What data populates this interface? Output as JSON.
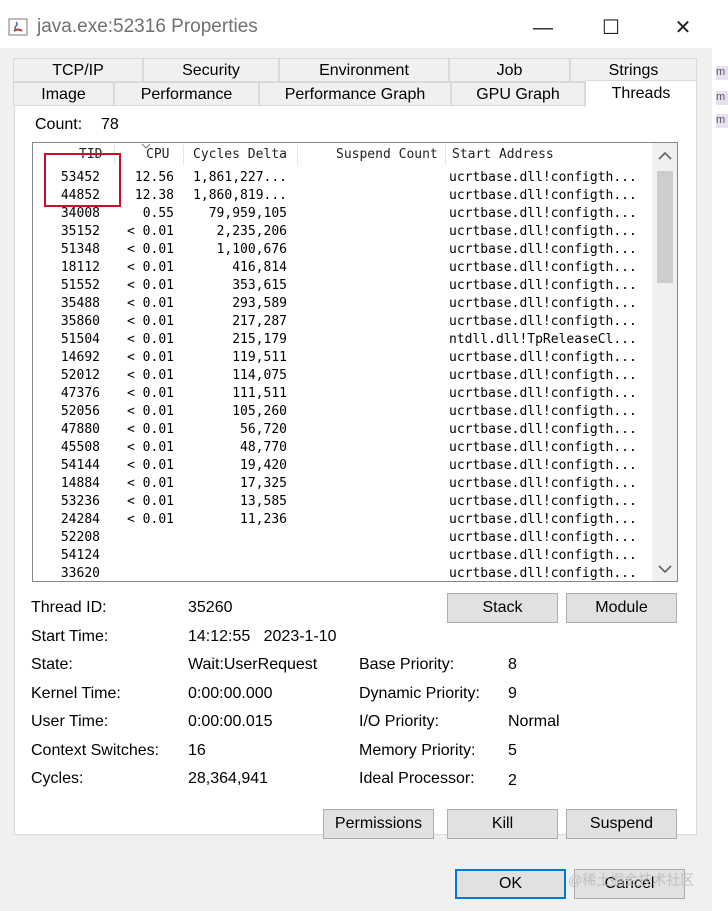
{
  "window": {
    "title": "java.exe:52316 Properties",
    "minimize_glyph": "—",
    "maximize_glyph": "☐",
    "close_glyph": "✕"
  },
  "tabs_row1": [
    "TCP/IP",
    "Security",
    "Environment",
    "Job",
    "Strings"
  ],
  "tabs_row2": [
    "Image",
    "Performance",
    "Performance Graph",
    "GPU Graph",
    "Threads"
  ],
  "active_tab": "Threads",
  "count": {
    "label": "Count:",
    "value": "78"
  },
  "thread_list": {
    "columns": [
      "TID",
      "CPU",
      "Cycles Delta",
      "Suspend Count",
      "Start Address"
    ],
    "rows": [
      {
        "tid": "53452",
        "cpu": "12.56",
        "cycles": "1,861,227...",
        "addr": "ucrtbase.dll!configth..."
      },
      {
        "tid": "44852",
        "cpu": "12.38",
        "cycles": "1,860,819...",
        "addr": "ucrtbase.dll!configth..."
      },
      {
        "tid": "34008",
        "cpu": "0.55",
        "cycles": "79,959,105",
        "addr": "ucrtbase.dll!configth..."
      },
      {
        "tid": "35152",
        "cpu": "< 0.01",
        "cycles": "2,235,206",
        "addr": "ucrtbase.dll!configth..."
      },
      {
        "tid": "51348",
        "cpu": "< 0.01",
        "cycles": "1,100,676",
        "addr": "ucrtbase.dll!configth..."
      },
      {
        "tid": "18112",
        "cpu": "< 0.01",
        "cycles": "416,814",
        "addr": "ucrtbase.dll!configth..."
      },
      {
        "tid": "51552",
        "cpu": "< 0.01",
        "cycles": "353,615",
        "addr": "ucrtbase.dll!configth..."
      },
      {
        "tid": "35488",
        "cpu": "< 0.01",
        "cycles": "293,589",
        "addr": "ucrtbase.dll!configth..."
      },
      {
        "tid": "35860",
        "cpu": "< 0.01",
        "cycles": "217,287",
        "addr": "ucrtbase.dll!configth..."
      },
      {
        "tid": "51504",
        "cpu": "< 0.01",
        "cycles": "215,179",
        "addr": "ntdll.dll!TpReleaseCl..."
      },
      {
        "tid": "14692",
        "cpu": "< 0.01",
        "cycles": "119,511",
        "addr": "ucrtbase.dll!configth..."
      },
      {
        "tid": "52012",
        "cpu": "< 0.01",
        "cycles": "114,075",
        "addr": "ucrtbase.dll!configth..."
      },
      {
        "tid": "47376",
        "cpu": "< 0.01",
        "cycles": "111,511",
        "addr": "ucrtbase.dll!configth..."
      },
      {
        "tid": "52056",
        "cpu": "< 0.01",
        "cycles": "105,260",
        "addr": "ucrtbase.dll!configth..."
      },
      {
        "tid": "47880",
        "cpu": "< 0.01",
        "cycles": "56,720",
        "addr": "ucrtbase.dll!configth..."
      },
      {
        "tid": "45508",
        "cpu": "< 0.01",
        "cycles": "48,770",
        "addr": "ucrtbase.dll!configth..."
      },
      {
        "tid": "54144",
        "cpu": "< 0.01",
        "cycles": "19,420",
        "addr": "ucrtbase.dll!configth..."
      },
      {
        "tid": "14884",
        "cpu": "< 0.01",
        "cycles": "17,325",
        "addr": "ucrtbase.dll!configth..."
      },
      {
        "tid": "53236",
        "cpu": "< 0.01",
        "cycles": "13,585",
        "addr": "ucrtbase.dll!configth..."
      },
      {
        "tid": "24284",
        "cpu": "< 0.01",
        "cycles": "11,236",
        "addr": "ucrtbase.dll!configth..."
      },
      {
        "tid": "52208",
        "cpu": "",
        "cycles": "",
        "addr": "ucrtbase.dll!configth..."
      },
      {
        "tid": "54124",
        "cpu": "",
        "cycles": "",
        "addr": "ucrtbase.dll!configth..."
      },
      {
        "tid": "33620",
        "cpu": "",
        "cycles": "",
        "addr": "ucrtbase.dll!configth..."
      }
    ]
  },
  "details": {
    "thread_id_label": "Thread ID:",
    "thread_id": "35260",
    "start_time_label": "Start Time:",
    "start_time": "14:12:55   2023-1-10",
    "state_label": "State:",
    "state": "Wait:UserRequest",
    "kernel_time_label": "Kernel Time:",
    "kernel_time": "0:00:00.000",
    "user_time_label": "User Time:",
    "user_time": "0:00:00.015",
    "context_switches_label": "Context Switches:",
    "context_switches": "16",
    "cycles_label": "Cycles:",
    "cycles": "28,364,941",
    "base_priority_label": "Base Priority:",
    "base_priority": "8",
    "dynamic_priority_label": "Dynamic Priority:",
    "dynamic_priority": "9",
    "io_priority_label": "I/O Priority:",
    "io_priority": "Normal",
    "memory_priority_label": "Memory Priority:",
    "memory_priority": "5",
    "ideal_processor_label": "Ideal Processor:",
    "ideal_processor": "2"
  },
  "buttons": {
    "stack": "Stack",
    "module": "Module",
    "permissions": "Permissions",
    "kill": "Kill",
    "suspend": "Suspend",
    "ok": "OK",
    "cancel": "Cancel"
  },
  "right_edge_chars": [
    "m",
    "m",
    "m"
  ],
  "watermark": "@稀土掘金技术社区"
}
